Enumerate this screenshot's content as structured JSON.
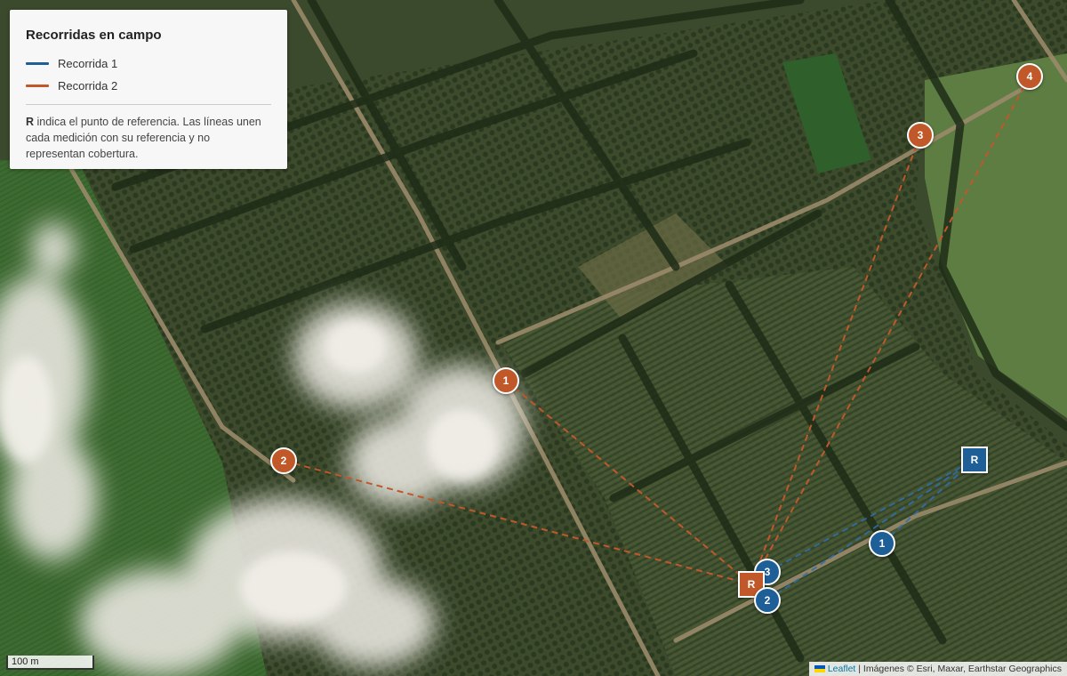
{
  "legend": {
    "title": "Recorridas en campo",
    "routes": [
      {
        "label": "Recorrida 1",
        "color": "#1f5f97"
      },
      {
        "label": "Recorrida 2",
        "color": "#c0582a"
      }
    ],
    "note_bold": "R",
    "note_text": " indica el punto de referencia. Las líneas unen cada medición con su referencia y no representan cobertura."
  },
  "markers": {
    "route1_ref": "R",
    "route2_ref": "R",
    "route1": [
      "1",
      "2",
      "3"
    ],
    "route2": [
      "1",
      "2",
      "3",
      "4"
    ]
  },
  "colors": {
    "route1": "#1f5f97",
    "route2": "#c0582a"
  },
  "scale": {
    "label": "100 m"
  },
  "attribution": {
    "link": "Leaflet",
    "separator": " | ",
    "text": "Imágenes © Esri, Maxar, Earthstar Geographics"
  }
}
